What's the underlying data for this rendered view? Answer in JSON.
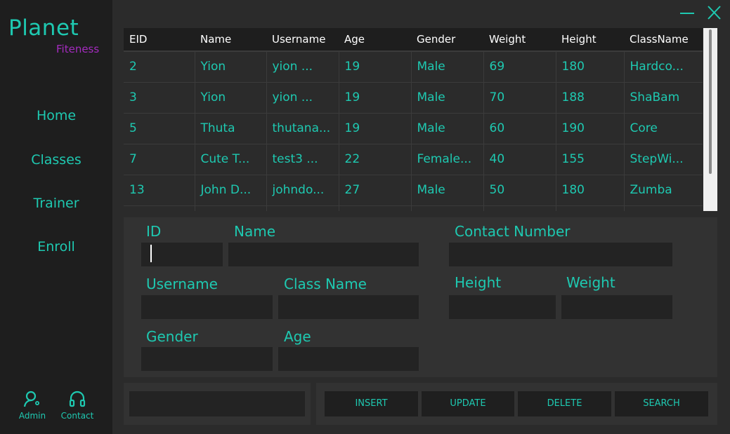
{
  "brand": {
    "line1": "Planet",
    "line2": "Fiteness"
  },
  "nav": [
    "Home",
    "Classes",
    "Trainer",
    "Enroll"
  ],
  "footer": {
    "admin_label": "Admin",
    "contact_label": "Contact"
  },
  "window_controls": {
    "minimize": "—",
    "close": "✕"
  },
  "table": {
    "columns": [
      "EID",
      "Name",
      "Username",
      "Age",
      "Gender",
      "Weight",
      "Height",
      "ClassName"
    ],
    "rows": [
      [
        "2",
        "Yion",
        "yion      ...",
        "19",
        "Male",
        "69",
        "180",
        "Hardco..."
      ],
      [
        "3",
        "Yion",
        "yion      ...",
        "19",
        "Male",
        "70",
        "188",
        "ShaBam"
      ],
      [
        "5",
        "Thuta",
        "thutana...",
        "19",
        "Male",
        "60",
        "190",
        "Core"
      ],
      [
        "7",
        "Cute T...",
        "test3     ...",
        "22",
        "Female...",
        "40",
        "155",
        "StepWi..."
      ],
      [
        "13",
        "John D...",
        "johndo...",
        "27",
        "Male",
        "50",
        "180",
        "Zumba"
      ]
    ]
  },
  "form": {
    "id_label": "ID",
    "name_label": "Name",
    "contact_label": "Contact Number",
    "username_label": "Username",
    "classname_label": "Class Name",
    "height_label": "Height",
    "weight_label": "Weight",
    "gender_label": "Gender",
    "age_label": "Age",
    "values": {
      "id": "",
      "name": "",
      "contact": "",
      "username": "",
      "classname": "",
      "height": "",
      "weight": "",
      "gender": "",
      "age": "",
      "search": ""
    }
  },
  "actions": {
    "insert": "INSERT",
    "update": "UPDATE",
    "delete": "DELETE",
    "search": "SEARCH"
  },
  "colors": {
    "accent": "#1ec9b1",
    "brand_secondary": "#a42bbf",
    "sidebar": "#1e1e1e",
    "background": "#2b2b2b",
    "panel": "#323232"
  }
}
